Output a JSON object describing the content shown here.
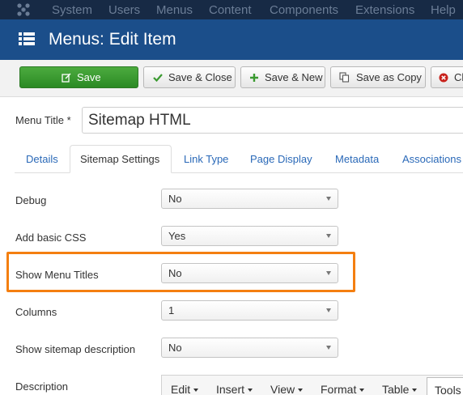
{
  "topnav": {
    "items": [
      "System",
      "Users",
      "Menus",
      "Content",
      "Components",
      "Extensions",
      "Help"
    ]
  },
  "header": {
    "title": "Menus: Edit Item"
  },
  "toolbar": {
    "save": "Save",
    "save_close": "Save & Close",
    "save_new": "Save & New",
    "save_copy": "Save as Copy",
    "close": "Cl"
  },
  "form": {
    "menu_title_label": "Menu Title *",
    "menu_title_value": "Sitemap HTML"
  },
  "tabs": [
    "Details",
    "Sitemap Settings",
    "Link Type",
    "Page Display",
    "Metadata",
    "Associations"
  ],
  "active_tab": "Sitemap Settings",
  "fields": [
    {
      "label": "Debug",
      "value": "No"
    },
    {
      "label": "Add basic CSS",
      "value": "Yes"
    },
    {
      "label": "Show Menu Titles",
      "value": "No"
    },
    {
      "label": "Columns",
      "value": "1"
    },
    {
      "label": "Show sitemap description",
      "value": "No"
    }
  ],
  "description": {
    "label": "Description",
    "editor_menus": [
      "Edit",
      "Insert",
      "View",
      "Format",
      "Table"
    ],
    "editor_tools": "Tools"
  },
  "colors": {
    "topnav_bg": "#172a45",
    "header_bg": "#1b4e8a",
    "save_green": "#3a9a30",
    "highlight_orange": "#f47f10",
    "link_blue": "#2a69b8"
  },
  "icons": {
    "joomla": "joomla-logo-icon",
    "menu": "list-icon",
    "save": "edit-icon",
    "save_close": "check-icon",
    "save_new": "plus-icon",
    "save_copy": "copy-icon",
    "close": "close-circle-icon"
  }
}
